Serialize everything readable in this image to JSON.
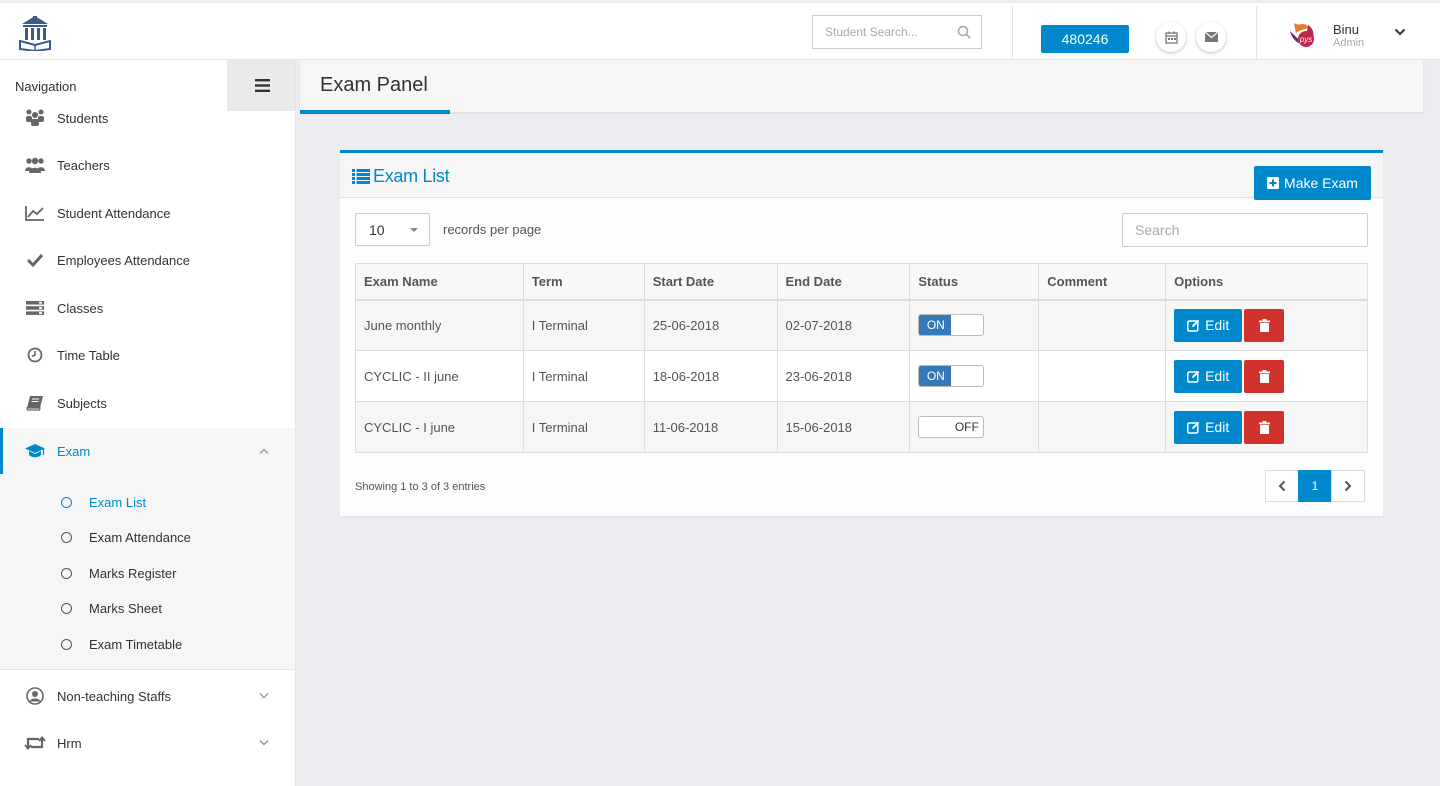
{
  "header": {
    "search_placeholder": "Student Search...",
    "code_badge": "480246",
    "user_name": "Binu",
    "user_role": "Admin",
    "avatar_text": "pys"
  },
  "sidebar": {
    "title": "Navigation",
    "items": [
      {
        "label": "Students",
        "icon": "students-icon"
      },
      {
        "label": "Teachers",
        "icon": "teachers-icon"
      },
      {
        "label": "Student Attendance",
        "icon": "chart-line-icon"
      },
      {
        "label": "Employees Attendance",
        "icon": "check-icon"
      },
      {
        "label": "Classes",
        "icon": "classes-icon"
      },
      {
        "label": "Time Table",
        "icon": "clock-icon"
      },
      {
        "label": "Subjects",
        "icon": "book-icon"
      },
      {
        "label": "Exam",
        "icon": "graduation-cap-icon"
      },
      {
        "label": "Non-teaching Staffs",
        "icon": "user-circle-icon"
      },
      {
        "label": "Hrm",
        "icon": "retweet-icon"
      }
    ],
    "exam_submenu": [
      {
        "label": "Exam List"
      },
      {
        "label": "Exam Attendance"
      },
      {
        "label": "Marks Register"
      },
      {
        "label": "Marks Sheet"
      },
      {
        "label": "Exam Timetable"
      }
    ]
  },
  "page": {
    "title": "Exam Panel"
  },
  "panel": {
    "title": "Exam List",
    "make_button": "Make Exam",
    "page_length": "10",
    "length_label": "records per page",
    "search_placeholder": "Search",
    "columns": [
      "Exam Name",
      "Term",
      "Start Date",
      "End Date",
      "Status",
      "Comment",
      "Options"
    ],
    "rows": [
      {
        "name": "June monthly",
        "term": "I Terminal",
        "start": "25-06-2018",
        "end": "02-07-2018",
        "status": "ON",
        "comment": ""
      },
      {
        "name": "CYCLIC - II june",
        "term": "I Terminal",
        "start": "18-06-2018",
        "end": "23-06-2018",
        "status": "ON",
        "comment": ""
      },
      {
        "name": "CYCLIC - I june",
        "term": "I Terminal",
        "start": "11-06-2018",
        "end": "15-06-2018",
        "status": "OFF",
        "comment": ""
      }
    ],
    "edit_label": "Edit",
    "info": "Showing 1 to 3 of 3 entries",
    "current_page": "1"
  },
  "colors": {
    "accent": "#0088cc",
    "danger": "#d2322d",
    "toggle_on": "#337ab7"
  }
}
